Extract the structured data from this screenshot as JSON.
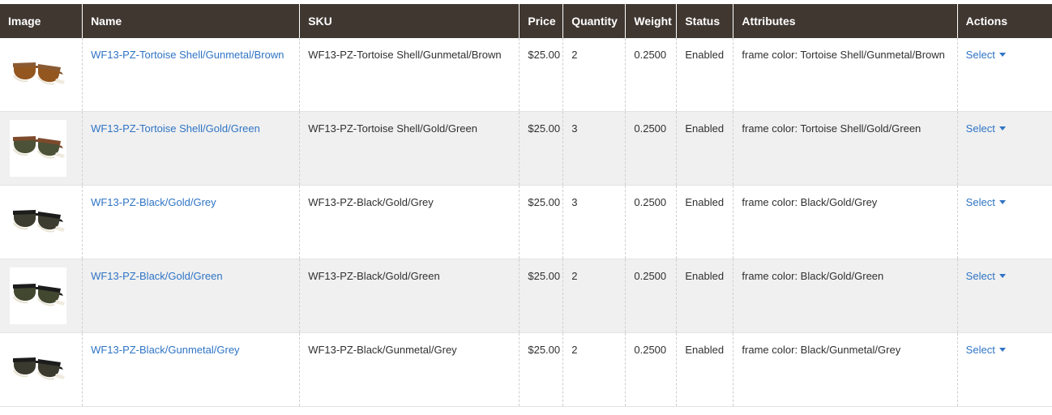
{
  "grid": {
    "columns": [
      {
        "key": "image",
        "label": "Image"
      },
      {
        "key": "name",
        "label": "Name"
      },
      {
        "key": "sku",
        "label": "SKU"
      },
      {
        "key": "price",
        "label": "Price"
      },
      {
        "key": "quantity",
        "label": "Quantity"
      },
      {
        "key": "weight",
        "label": "Weight"
      },
      {
        "key": "status",
        "label": "Status"
      },
      {
        "key": "attributes",
        "label": "Attributes"
      },
      {
        "key": "actions",
        "label": "Actions"
      }
    ],
    "action_label": "Select",
    "action_icon": "chevron-down-icon",
    "colors": {
      "header_bg": "#403731",
      "header_text": "#ffffff",
      "link": "#2f74c5",
      "row_alt_bg": "#f0f0f0",
      "text": "#303030"
    },
    "rows": [
      {
        "image_alt": "sunglasses-thumbnail",
        "frame_color": "#8a5a33",
        "lens_color": "#94561f",
        "name": "WF13-PZ-Tortoise Shell/Gunmetal/Brown",
        "sku": "WF13-PZ-Tortoise Shell/Gunmetal/Brown",
        "price": "$25.00",
        "quantity": "2",
        "weight": "0.2500",
        "status": "Enabled",
        "attributes": "frame color: Tortoise Shell/Gunmetal/Brown",
        "action": "Select"
      },
      {
        "image_alt": "sunglasses-thumbnail",
        "frame_color": "#7d4a2c",
        "lens_color": "#4c5237",
        "name": "WF13-PZ-Tortoise Shell/Gold/Green",
        "sku": "WF13-PZ-Tortoise Shell/Gold/Green",
        "price": "$25.00",
        "quantity": "3",
        "weight": "0.2500",
        "status": "Enabled",
        "attributes": "frame color: Tortoise Shell/Gold/Green",
        "action": "Select"
      },
      {
        "image_alt": "sunglasses-thumbnail",
        "frame_color": "#1c1c1c",
        "lens_color": "#3c3c30",
        "name": "WF13-PZ-Black/Gold/Grey",
        "sku": "WF13-PZ-Black/Gold/Grey",
        "price": "$25.00",
        "quantity": "3",
        "weight": "0.2500",
        "status": "Enabled",
        "attributes": "frame color: Black/Gold/Grey",
        "action": "Select"
      },
      {
        "image_alt": "sunglasses-thumbnail",
        "frame_color": "#1c1c1c",
        "lens_color": "#42482f",
        "name": "WF13-PZ-Black/Gold/Green",
        "sku": "WF13-PZ-Black/Gold/Green",
        "price": "$25.00",
        "quantity": "2",
        "weight": "0.2500",
        "status": "Enabled",
        "attributes": "frame color: Black/Gold/Green",
        "action": "Select"
      },
      {
        "image_alt": "sunglasses-thumbnail",
        "frame_color": "#1c1c1c",
        "lens_color": "#3a3a2f",
        "name": "WF13-PZ-Black/Gunmetal/Grey",
        "sku": "WF13-PZ-Black/Gunmetal/Grey",
        "price": "$25.00",
        "quantity": "2",
        "weight": "0.2500",
        "status": "Enabled",
        "attributes": "frame color: Black/Gunmetal/Grey",
        "action": "Select"
      }
    ]
  }
}
